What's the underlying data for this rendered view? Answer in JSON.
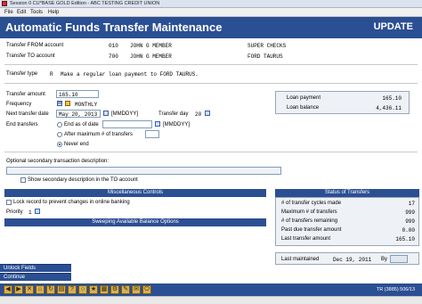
{
  "window": {
    "title": "Session 0 CU*BASE GOLD Edition - ABC TESTING CREDIT UNION"
  },
  "menu": {
    "file": "File",
    "edit": "Edit",
    "tools": "Tools",
    "help": "Help"
  },
  "header": {
    "title": "Automatic Funds Transfer Maintenance",
    "mode": "UPDATE"
  },
  "from": {
    "label": "Transfer FROM account",
    "number": "010",
    "name": "JOHN G MEMBER",
    "desc": "SUPER CHECKS"
  },
  "to": {
    "label": "Transfer TO account",
    "number": "700",
    "name": "JOHN G MEMBER",
    "desc": "FORD TAURUS"
  },
  "type": {
    "label": "Transfer type",
    "code": "R",
    "desc": "Make a regular loan payment to FORD TAURUS."
  },
  "amount": {
    "label": "Transfer amount",
    "value": "165.10"
  },
  "frequency": {
    "label": "Frequency",
    "code": "M",
    "value": "MONTHLY"
  },
  "next_date": {
    "label": "Next transfer date",
    "value": "May 20, 2013",
    "format": "[MMDDYY]"
  },
  "transfer_day": {
    "label": "Transfer day",
    "value": "20"
  },
  "end": {
    "label": "End transfers",
    "options": {
      "end_as_of": "End as of date",
      "after_max": "After maximum # of transfers",
      "never": "Never end"
    },
    "format": "[MMDDYY]",
    "selected": "never"
  },
  "loan": {
    "payment_label": "Loan payment",
    "payment_value": "165.10",
    "balance_label": "Loan balance",
    "balance_value": "4,436.11"
  },
  "secondary": {
    "label": "Optional secondary transaction description:",
    "value": "",
    "show_label": "Show secondary description in the TO account"
  },
  "misc": {
    "title": "Miscellaneous Controls",
    "lock_label": "Lock record to prevent changes in online banking",
    "priority_label": "Priority",
    "priority_value": "1",
    "sweep_title": "Sweeping Available Balance Options"
  },
  "status": {
    "title": "Status of Transfers",
    "rows": [
      {
        "label": "# of transfer cycles made",
        "value": "17"
      },
      {
        "label": "Maximum # of transfers",
        "value": "999"
      },
      {
        "label": "# of transfers remaining",
        "value": "999"
      },
      {
        "label": "Past due transfer amount",
        "value": "0.00"
      },
      {
        "label": "Last transfer amount",
        "value": "165.10"
      }
    ],
    "last_maintained_label": "Last maintained",
    "last_maintained_value": "Dec 19, 2011",
    "by_label": "By"
  },
  "buttons": {
    "unlock": "Unlock Fields",
    "continue": "Continue"
  },
  "toolbar": {
    "icons": [
      "back-arrow-icon",
      "next-arrow-icon",
      "stop-icon",
      "home-icon",
      "refresh-icon",
      "print-icon",
      "help-icon",
      "search-icon",
      "bookmark-icon",
      "calendar-icon",
      "tools-icon",
      "notes-icon",
      "mail-icon",
      "logout-icon"
    ],
    "code": "TR (3885) 506/13"
  }
}
